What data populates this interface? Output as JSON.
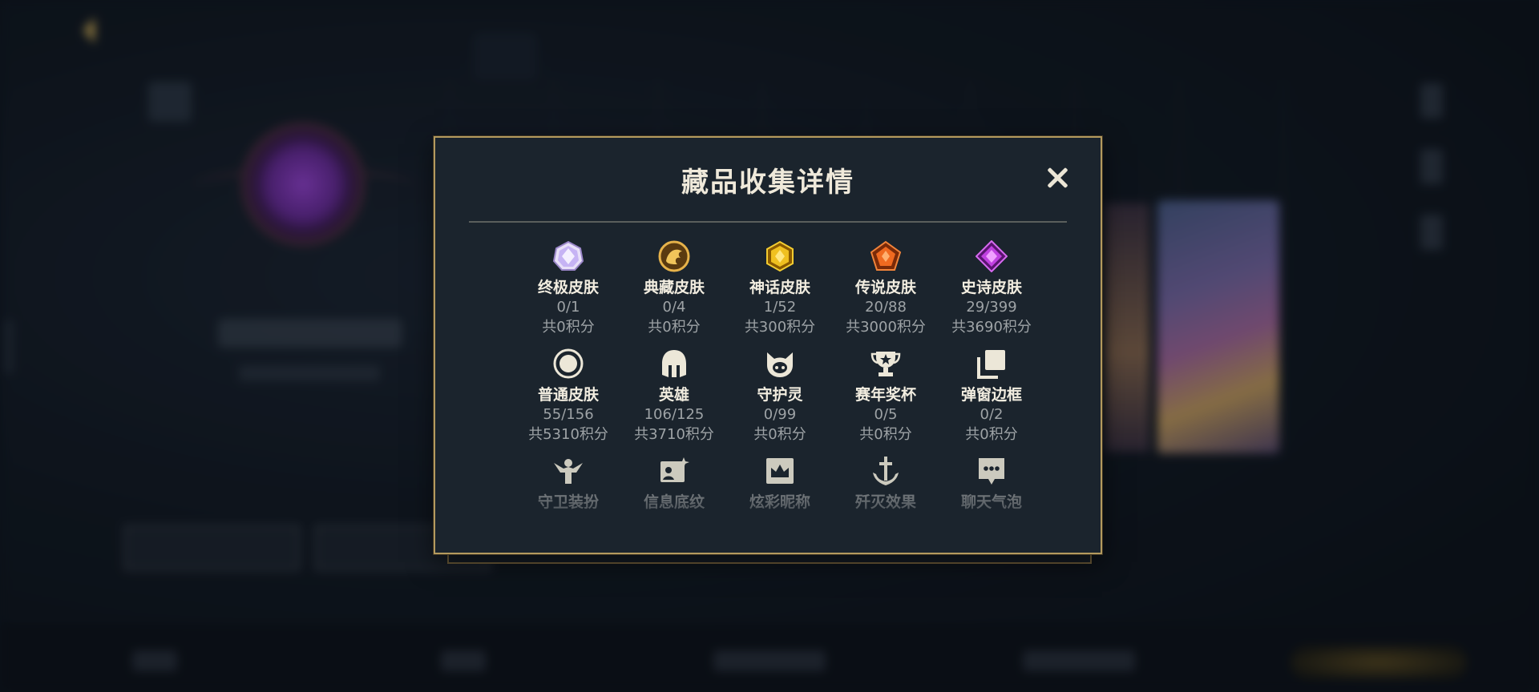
{
  "modal": {
    "title": "藏品收集详情",
    "close_icon": "close-icon",
    "items": [
      {
        "name": "终极皮肤",
        "count": "0/1",
        "points": "共0积分",
        "icon": "ultimate-skin-gem-icon",
        "color": "#b79df0"
      },
      {
        "name": "典藏皮肤",
        "count": "0/4",
        "points": "共0积分",
        "icon": "collection-dragon-icon",
        "color": "#d49a30"
      },
      {
        "name": "神话皮肤",
        "count": "1/52",
        "points": "共300积分",
        "icon": "mythic-gem-icon",
        "color": "#f0c020"
      },
      {
        "name": "传说皮肤",
        "count": "20/88",
        "points": "共3000积分",
        "icon": "legend-gem-icon",
        "color": "#f06a20"
      },
      {
        "name": "史诗皮肤",
        "count": "29/399",
        "points": "共3690积分",
        "icon": "epic-gem-icon",
        "color": "#c040e0"
      },
      {
        "name": "普通皮肤",
        "count": "55/156",
        "points": "共5310积分",
        "icon": "normal-skin-circle-icon",
        "color": "#e8e3d4"
      },
      {
        "name": "英雄",
        "count": "106/125",
        "points": "共3710积分",
        "icon": "hero-helmet-icon",
        "color": "#e8e3d4"
      },
      {
        "name": "守护灵",
        "count": "0/99",
        "points": "共0积分",
        "icon": "guardian-spirit-icon",
        "color": "#e8e3d4"
      },
      {
        "name": "赛年奖杯",
        "count": "0/5",
        "points": "共0积分",
        "icon": "trophy-icon",
        "color": "#e8e3d4"
      },
      {
        "name": "弹窗边框",
        "count": "0/2",
        "points": "共0积分",
        "icon": "popup-frame-icon",
        "color": "#e8e3d4"
      },
      {
        "name": "守卫装扮",
        "count": "",
        "points": "",
        "icon": "guard-costume-icon",
        "color": "#e8e3d4"
      },
      {
        "name": "信息底纹",
        "count": "",
        "points": "",
        "icon": "info-background-icon",
        "color": "#e8e3d4"
      },
      {
        "name": "炫彩昵称",
        "count": "",
        "points": "",
        "icon": "colorful-nickname-icon",
        "color": "#e8e3d4"
      },
      {
        "name": "歼灭效果",
        "count": "",
        "points": "",
        "icon": "annihilation-effect-icon",
        "color": "#e8e3d4"
      },
      {
        "name": "聊天气泡",
        "count": "",
        "points": "",
        "icon": "chat-bubble-icon",
        "color": "#e8e3d4"
      }
    ]
  },
  "colors": {
    "modal_border": "#b49a5e",
    "modal_bg": "#1b242d",
    "accent_gold": "#d8b45a"
  }
}
